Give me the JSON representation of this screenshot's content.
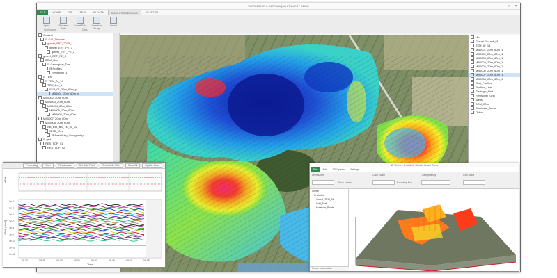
{
  "window": {
    "title": "WORKBENCH - ALPHA AQUA PROJECT DEMO",
    "min": "–",
    "max": "□",
    "close": "✕"
  },
  "tabs": [
    {
      "label": "FILE",
      "kind": "file"
    },
    {
      "label": "HOME",
      "kind": ""
    },
    {
      "label": "GIS",
      "kind": ""
    },
    {
      "label": "TEM",
      "kind": ""
    },
    {
      "label": "3D DATA",
      "kind": ""
    },
    {
      "label": "DATA PROCESSING",
      "kind": "active"
    },
    {
      "label": "SCATTER",
      "kind": ""
    }
  ],
  "ribbon": {
    "buttons": [
      "Open",
      "Process Data",
      "Export Data",
      "Inversion Setup",
      "Import"
    ],
    "groups": [
      "Workspace",
      "Data"
    ]
  },
  "tree": [
    {
      "label": "Gravvel",
      "cls": ""
    },
    {
      "label": "⊟ GIS_Themes",
      "cls": "red"
    },
    {
      "label": "gravel_ERT_2015_1",
      "cls": "red"
    },
    {
      "label": "gravel_ERT_PE_1",
      "cls": ""
    },
    {
      "label": "gravel_ERT_PE_2",
      "cls": ""
    },
    {
      "label": "gravel_ERT_PE_3",
      "cls": ""
    },
    {
      "label": "DEM_Grid",
      "cls": ""
    },
    {
      "label": "⊟ Geological_Tom",
      "cls": ""
    },
    {
      "label": "⊟ Profiles",
      "cls": ""
    },
    {
      "label": "Resistivity_1",
      "cls": ""
    },
    {
      "label": "⊟ TEM",
      "cls": ""
    },
    {
      "label": "⊟ TEM_Ar_14",
      "cls": ""
    },
    {
      "label": "TEM_line_1",
      "cls": ""
    },
    {
      "label": "SKB_01_20m_60m_p",
      "cls": ""
    },
    {
      "label": "MB0001_20m_60m_p",
      "cls": "sel"
    },
    {
      "label": "MB0002_20m_60m",
      "cls": ""
    },
    {
      "label": "MB0003_20m_60m",
      "cls": ""
    },
    {
      "label": "MB0004_20m_60m",
      "cls": ""
    },
    {
      "label": "MB0005_20m_60m",
      "cls": ""
    },
    {
      "label": "MB0006_20m_60m",
      "cls": ""
    },
    {
      "label": "MB0007_20m_60m",
      "cls": ""
    },
    {
      "label": "MB0008_20m_60m",
      "cls": ""
    },
    {
      "label": "NB_BIR_BS_TE_01_02",
      "cls": ""
    },
    {
      "label": "⊟ 3D_View",
      "cls": ""
    },
    {
      "label": "⊟ Resistivity_Topography",
      "cls": ""
    },
    {
      "label": "⊟ grid",
      "cls": ""
    },
    {
      "label": "RES_TOP_01",
      "cls": ""
    },
    {
      "label": "RES_TOP_02",
      "cls": ""
    }
  ],
  "legend": [
    {
      "label": "Mo",
      "cls": ""
    },
    {
      "label": "Gravel Ground_01",
      "cls": ""
    },
    {
      "label": "TEM_Ar_14",
      "cls": ""
    },
    {
      "label": "MB0001_20m_60m_1",
      "cls": ""
    },
    {
      "label": "MB0002_20m_60m_1",
      "cls": ""
    },
    {
      "label": "MB0003_20m_60m_1",
      "cls": ""
    },
    {
      "label": "MB0004_20m_60m_1",
      "cls": ""
    },
    {
      "label": "MB0005_20m_60m_1",
      "cls": ""
    },
    {
      "label": "MB0006_20m_60m_1",
      "cls": ""
    },
    {
      "label": "MB0007_20m_60m_1",
      "cls": "sel"
    },
    {
      "label": "MB0008_20m_60m_1",
      "cls": ""
    },
    {
      "label": "Grid_Profiles",
      "cls": ""
    },
    {
      "label": "Profiles_Line",
      "cls": ""
    },
    {
      "label": "Geologic_Unit",
      "cls": ""
    },
    {
      "label": "Resistivity_Grid",
      "cls": ""
    },
    {
      "label": "Wells",
      "cls": ""
    },
    {
      "label": "DEM_20m",
      "cls": ""
    },
    {
      "label": "Cadastral_Areas",
      "cls": ""
    },
    {
      "label": "Ortho",
      "cls": ""
    }
  ],
  "timeseries": {
    "toolbar": [
      "Processing",
      "Save",
      "Recalculate",
      "Set Data Point",
      "Show/Hide Filter",
      "Show All",
      "Update Chart"
    ],
    "top_ylabel": "dB/dt",
    "bottom_ylabel": "dB/dt [V/m²]",
    "xlabel": "Time",
    "yticks_bottom": [
      "1e-4",
      "1e-5",
      "1e-6",
      "1e-7",
      "1e-8",
      "1e-9",
      "1e-10",
      "1e-11",
      "1e-12"
    ],
    "xticks": [
      "09:20",
      "09:25",
      "09:30",
      "09:35",
      "09:40",
      "09:45",
      "09:50",
      "09:55"
    ]
  },
  "view3d": {
    "title": "3D Viewer - Resistivity Models Gravel Demo",
    "tabs": [
      "File",
      "Edit",
      "3D Options",
      "Settings"
    ],
    "labels": [
      "Item Name",
      "Color Scale",
      "Transparency",
      "Grid Mode",
      "Show Labels",
      "Bounding Box"
    ],
    "tree": [
      "Scene",
      "⊟ Models",
      "Gravel_TEM_01",
      "Grid_Surf",
      "Borehole_Points"
    ],
    "footer": "Scene Information"
  },
  "colors": {
    "accent": "#2f8a4c",
    "selection": "#cfe3f7"
  }
}
